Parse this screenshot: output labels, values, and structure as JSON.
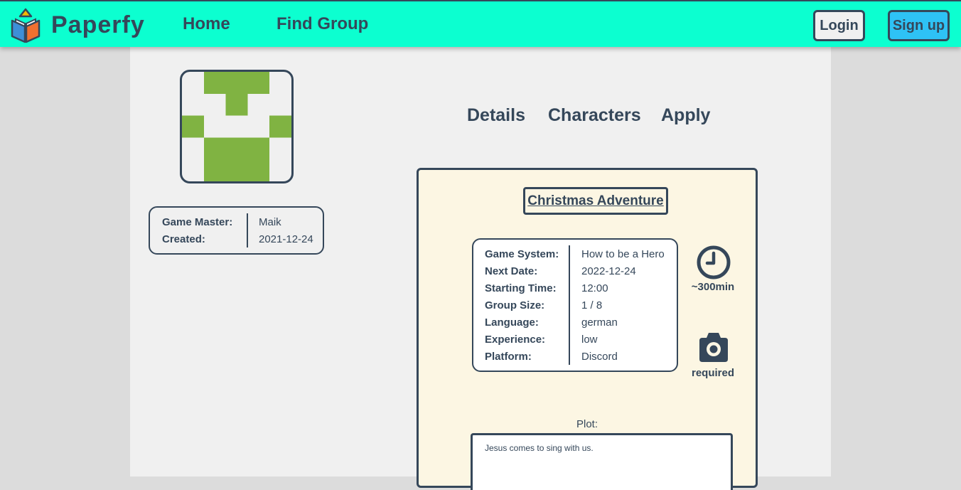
{
  "navbar": {
    "brand": "Paperfy",
    "links": {
      "home": "Home",
      "find_group": "Find Group"
    },
    "buttons": {
      "login": "Login",
      "signup": "Sign up"
    },
    "logo_icon": "book-logo-icon",
    "colors": {
      "bar": "#0cffd0",
      "signup": "#2ec2f5",
      "login": "#f0f0f0"
    }
  },
  "avatar": {
    "icon": "identicon-avatar",
    "color": "#80b342"
  },
  "game_master": {
    "label": "Game Master:",
    "value": "Maik",
    "created_label": "Created:",
    "created_value": "2021-12-24"
  },
  "tabs": {
    "details": "Details",
    "characters": "Characters",
    "apply": "Apply"
  },
  "group": {
    "title": "Christmas Adventure",
    "info": [
      {
        "label": "Game System:",
        "value": "How to be a Hero"
      },
      {
        "label": "Next Date:",
        "value": "2022-12-24"
      },
      {
        "label": "Starting Time:",
        "value": "12:00"
      },
      {
        "label": "Group Size:",
        "value": "1 / 8"
      },
      {
        "label": "Language:",
        "value": "german"
      },
      {
        "label": "Experience:",
        "value": "low"
      },
      {
        "label": "Platform:",
        "value": "Discord"
      }
    ],
    "duration": "~300min",
    "duration_icon": "clock-icon",
    "camera": "required",
    "camera_icon": "camera-icon",
    "plot_label": "Plot:",
    "plot_text": "Jesus comes to sing with us."
  },
  "colors": {
    "text": "#35475a",
    "card_bg": "#fcf6e3",
    "panel_bg": "#f0f0f0",
    "page_bg": "#dcdcdc"
  }
}
